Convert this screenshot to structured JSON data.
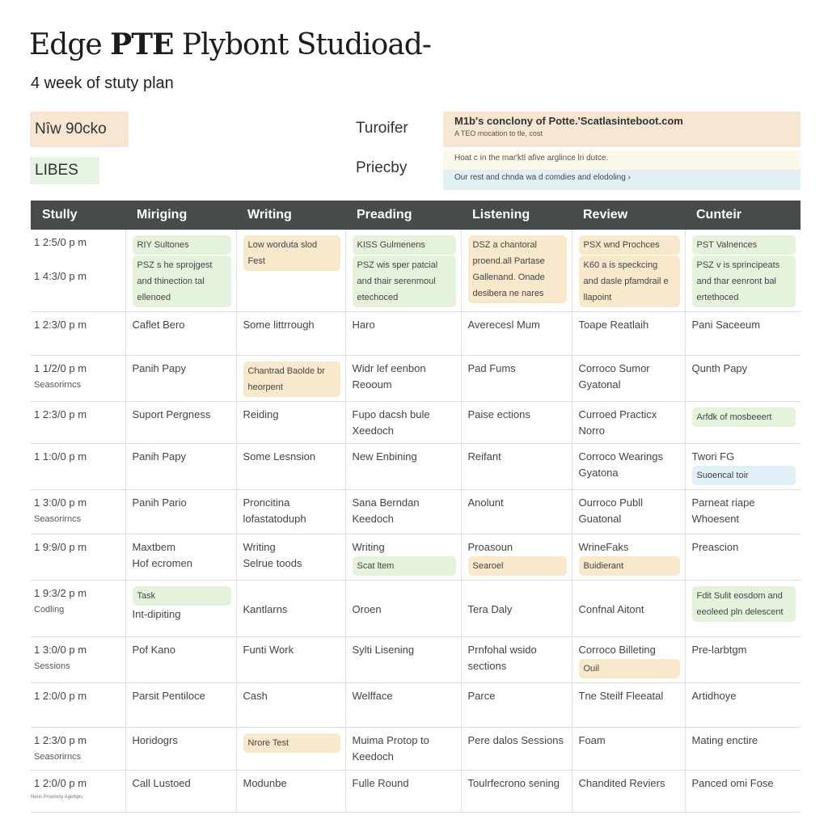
{
  "header": {
    "title_pre": "Edge ",
    "title_bold": "PTE",
    "title_post": " Plybont Studioad-",
    "subtitle": "4 week of stuty plan"
  },
  "tags": [
    "Nîw 90cko",
    "LIBES"
  ],
  "labels": [
    "Turoifer",
    "Priecby"
  ],
  "info": {
    "line1": "M1b's conclony of Potte.'Scatlasinteboot.com",
    "line1_sub": "A TEO mocation to tle, cost",
    "line2": "Hoat c in the mar'ktl afive arglince lri dutce.",
    "line3": "Our rest and chnda wa d comdies and elodoling ›"
  },
  "colors": {
    "header_bg": "#474c4b",
    "green": "#e5f3dc",
    "peach": "#f8e8cc",
    "blue": "#e1eff6"
  },
  "columns": [
    "Stully",
    "Miriging",
    "Writing",
    "Preading",
    "Listening",
    "Review",
    "Cunteir"
  ],
  "rows": [
    {
      "h": 94,
      "time": [
        "1 2:5/0 p m",
        "1 4:3/0 p m"
      ],
      "cells": [
        [
          {
            "chip": "green",
            "t": "RIY Sultones"
          },
          {
            "chip": "green",
            "t": "PSZ s he sprojgest and thinection tal ellenoed"
          }
        ],
        [
          {
            "chip": "peach",
            "t": "Low worduta slod Fest"
          }
        ],
        [
          {
            "chip": "green",
            "t": "KISS Gulmenens"
          },
          {
            "chip": "green",
            "t": "PSZ wis sper patcial and thair serenmoul etechoced"
          }
        ],
        [
          {
            "chip": "peach",
            "t": "DSZ a chantoral proend.all Partase Gallenand. Onade desibera ne nares"
          }
        ],
        [
          {
            "chip": "peach",
            "t": "PSX wnd Prochces"
          },
          {
            "chip": "peach",
            "t": "K60 a is speckcing and dasle pfamdrail e llapoint"
          }
        ],
        [
          {
            "chip": "green",
            "t": "PST Valnences"
          },
          {
            "chip": "green",
            "t": "PSZ v is sprincipeats and thar eenront bal ertethoced"
          }
        ]
      ]
    },
    {
      "h": 54,
      "time": [
        "1 2:3/0 p m"
      ],
      "cells": [
        [
          {
            "t": "Caflet Bero"
          }
        ],
        [
          {
            "t": "Some littrrough"
          }
        ],
        [
          {
            "t": "Haro"
          }
        ],
        [
          {
            "t": "Averecesl Mum"
          }
        ],
        [
          {
            "t": "Toape Reatlaih"
          }
        ],
        [
          {
            "t": "Pani Saceeum"
          }
        ]
      ]
    },
    {
      "h": 56,
      "time": [
        "1 1/2/0 p m",
        "Seasorirncs"
      ],
      "cells": [
        [
          {
            "t": "Panih Papy"
          }
        ],
        [
          {
            "chip": "peach",
            "t": "Chantrad Baolde br heorpent"
          }
        ],
        [
          {
            "t": "Widr lef eenbon Reooum"
          }
        ],
        [
          {
            "t": "Pad Fums"
          }
        ],
        [
          {
            "t": "Corroco Sumor Gyatonal"
          }
        ],
        [
          {
            "t": "Qunth Papy"
          }
        ]
      ]
    },
    {
      "h": 52,
      "time": [
        "1 2:3/0 p m"
      ],
      "cells": [
        [
          {
            "t": "Suport Pergness"
          }
        ],
        [
          {
            "t": "Reiding"
          }
        ],
        [
          {
            "t": "Fupo dacsh bule Xeedoch"
          }
        ],
        [
          {
            "t": "Paise ections"
          }
        ],
        [
          {
            "t": "Curroed Practicx Norro"
          }
        ],
        [
          {
            "chip": "green",
            "t": "Arfdk of mosbeeert"
          }
        ]
      ]
    },
    {
      "h": 55,
      "time": [
        "1 1:0/0 p m"
      ],
      "cells": [
        [
          {
            "t": "Panih Papy"
          }
        ],
        [
          {
            "t": "Some Lesnsion"
          }
        ],
        [
          {
            "t": "New Enbining"
          }
        ],
        [
          {
            "t": "Reifant"
          }
        ],
        [
          {
            "t": "Corroco Wearings Gyatona"
          }
        ],
        [
          {
            "t": "Twori FG"
          },
          {
            "chip": "blue",
            "t": "Suoencal toir"
          }
        ]
      ]
    },
    {
      "h": 55,
      "time": [
        "1 3:0/0 p m",
        "Seasorirncs"
      ],
      "cells": [
        [
          {
            "t": "Panih Pario"
          }
        ],
        [
          {
            "t": "Proncitina lofastatoduph"
          }
        ],
        [
          {
            "t": "Sana Berndan Keedoch"
          }
        ],
        [
          {
            "t": "Anolunt"
          }
        ],
        [
          {
            "t": "Ourroco Publl Guatonal"
          }
        ],
        [
          {
            "t": "Parneat riape Whoesent"
          }
        ]
      ]
    },
    {
      "h": 55,
      "time": [
        "1 9:9/0 p m"
      ],
      "cells": [
        [
          {
            "t": "Maxtbem"
          },
          {
            "t": "Hof ecromen"
          }
        ],
        [
          {
            "t": "Writing"
          },
          {
            "t": "Selrue toods"
          }
        ],
        [
          {
            "t": "Writing"
          },
          {
            "chip": "green",
            "t": "Scat ltem"
          }
        ],
        [
          {
            "t": "Proasoun"
          },
          {
            "chip": "peach",
            "t": "Searoel"
          }
        ],
        [
          {
            "t": "WrineFaks"
          },
          {
            "chip": "peach",
            "t": "Buidierant"
          }
        ],
        [
          {
            "t": "Preascion"
          }
        ]
      ]
    },
    {
      "h": 70,
      "time": [
        "1 9:3/2 p m",
        "Codling"
      ],
      "cells": [
        [
          {
            "chip": "green",
            "t": "Task"
          },
          {
            "t": "Int-dipiting"
          }
        ],
        [
          {
            "t": ""
          },
          {
            "t": "Kantlarns"
          }
        ],
        [
          {
            "t": ""
          },
          {
            "t": "Oroen"
          }
        ],
        [
          {
            "t": ""
          },
          {
            "t": "Tera Daly"
          }
        ],
        [
          {
            "t": ""
          },
          {
            "t": "Confnal Aitont"
          }
        ],
        [
          {
            "chip": "green",
            "t": "Fdit Sulit eosdom and eeoleed pln delescent"
          }
        ]
      ]
    },
    {
      "h": 55,
      "time": [
        "1 3:0/0 p m",
        "Sessions"
      ],
      "cells": [
        [
          {
            "t": "Pof Kano"
          }
        ],
        [
          {
            "t": "Funti Work"
          }
        ],
        [
          {
            "t": "Sylti Lisening"
          }
        ],
        [
          {
            "t": "Prnfohal wsido sections"
          }
        ],
        [
          {
            "t": "Corroco Billeting"
          },
          {
            "chip": "peach",
            "t": "Ouil"
          }
        ],
        [
          {
            "t": "Pre-larbtgm"
          }
        ]
      ]
    },
    {
      "h": 55,
      "time": [
        "1 2:0/0 p m"
      ],
      "cells": [
        [
          {
            "t": "Parsit Pentiloce"
          }
        ],
        [
          {
            "t": "Cash"
          }
        ],
        [
          {
            "t": "Welfface"
          }
        ],
        [
          {
            "t": "Parce"
          }
        ],
        [
          {
            "t": "Tne Steilf Fleeatal"
          }
        ],
        [
          {
            "t": "Artidhoye"
          }
        ]
      ]
    },
    {
      "h": 53,
      "time": [
        "1 2:3/0 p m",
        "Seasorirncs"
      ],
      "cells": [
        [
          {
            "t": "Horidogrs"
          }
        ],
        [
          {
            "chip": "peach",
            "t": "Nrore Test"
          }
        ],
        [
          {
            "t": "Muima Protop to Keedoch"
          }
        ],
        [
          {
            "t": "Pere dalos Sessions"
          }
        ],
        [
          {
            "t": "Foam"
          }
        ],
        [
          {
            "t": "Mating enctire"
          }
        ]
      ]
    },
    {
      "h": 52,
      "time": [
        "1 2:0/0 p m"
      ],
      "cells": [
        [
          {
            "t": "Call Lustoed"
          }
        ],
        [
          {
            "t": "Modunbe"
          }
        ],
        [
          {
            "t": "Fulle Round"
          }
        ],
        [
          {
            "t": "Toulrfecrono sening"
          }
        ],
        [
          {
            "t": "Chandited Reviers"
          }
        ],
        [
          {
            "t": "Panced omi Fose"
          }
        ]
      ]
    }
  ],
  "footer": "Neus Proelocly Ageltipis"
}
